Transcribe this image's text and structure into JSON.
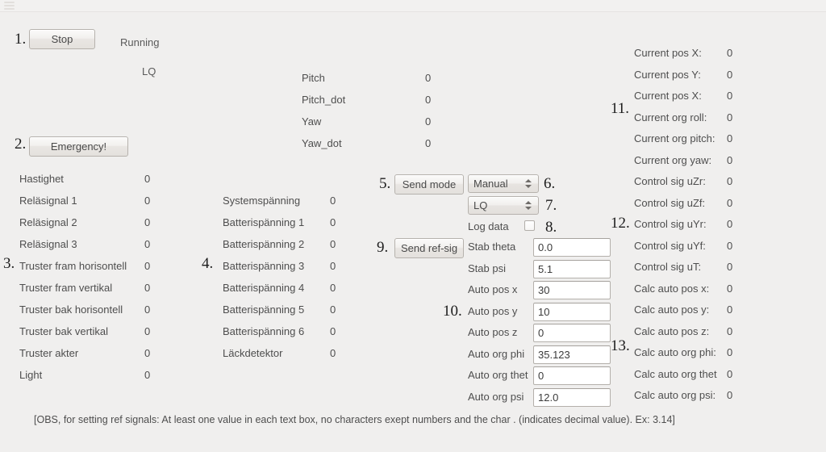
{
  "window": {
    "titlebar_icon": "menu-icon"
  },
  "controls": {
    "stop_button": "Stop",
    "emergency_button": "Emergency!",
    "send_mode_button": "Send mode",
    "send_refsig_button": "Send ref-sig",
    "mode_select_value": "Manual",
    "controller_select_value": "LQ",
    "log_data_label": "Log data",
    "log_data_checked": false
  },
  "status": {
    "running": "Running",
    "controller": "LQ"
  },
  "annotations": {
    "n1": "1.",
    "n2": "2.",
    "n3": "3.",
    "n4": "4.",
    "n5": "5.",
    "n6": "6.",
    "n7": "7.",
    "n8": "8.",
    "n9": "9.",
    "n10": "10.",
    "n11": "11.",
    "n12": "12.",
    "n13": "13."
  },
  "attitude": {
    "rows": [
      {
        "label": "Pitch",
        "value": "0"
      },
      {
        "label": "Pitch_dot",
        "value": "0"
      },
      {
        "label": "Yaw",
        "value": "0"
      },
      {
        "label": "Yaw_dot",
        "value": "0"
      }
    ]
  },
  "sensors_left": {
    "rows": [
      {
        "label": "Hastighet",
        "value": "0"
      },
      {
        "label": "Reläsignal 1",
        "value": "0"
      },
      {
        "label": "Reläsignal 2",
        "value": "0"
      },
      {
        "label": "Reläsignal 3",
        "value": "0"
      },
      {
        "label": "Truster fram horisontell",
        "value": "0"
      },
      {
        "label": "Truster fram vertikal",
        "value": "0"
      },
      {
        "label": "Truster bak horisontell",
        "value": "0"
      },
      {
        "label": "Truster bak vertikal",
        "value": "0"
      },
      {
        "label": "Truster akter",
        "value": "0"
      },
      {
        "label": "Light",
        "value": "0"
      }
    ]
  },
  "power": {
    "rows": [
      {
        "label": "Systemspänning",
        "value": "0"
      },
      {
        "label": "Batterispänning 1",
        "value": "0"
      },
      {
        "label": "Batterispänning 2",
        "value": "0"
      },
      {
        "label": "Batterispänning 3",
        "value": "0"
      },
      {
        "label": "Batterispänning 4",
        "value": "0"
      },
      {
        "label": "Batterispänning 5",
        "value": "0"
      },
      {
        "label": "Batterispänning 6",
        "value": "0"
      },
      {
        "label": "Läckdetektor",
        "value": "0"
      }
    ]
  },
  "refsig": {
    "rows": [
      {
        "label": "Stab theta",
        "value": "0.0"
      },
      {
        "label": "Stab psi",
        "value": "5.1"
      },
      {
        "label": "Auto pos x",
        "value": "30"
      },
      {
        "label": "Auto pos y",
        "value": "10"
      },
      {
        "label": "Auto pos z",
        "value": "0"
      },
      {
        "label": "Auto org phi",
        "value": "35.123"
      },
      {
        "label": "Auto org thet",
        "value": "0"
      },
      {
        "label": "Auto org psi",
        "value": "12.0"
      }
    ]
  },
  "readouts_right": {
    "rows": [
      {
        "label": "Current pos X:",
        "value": "0"
      },
      {
        "label": "Current pos Y:",
        "value": "0"
      },
      {
        "label": "Current pos X:",
        "value": "0"
      },
      {
        "label": "Current org roll:",
        "value": "0"
      },
      {
        "label": "Current org pitch:",
        "value": "0"
      },
      {
        "label": "Current org yaw:",
        "value": "0"
      },
      {
        "label": "Control sig uZr:",
        "value": "0"
      },
      {
        "label": "Control sig uZf:",
        "value": "0"
      },
      {
        "label": "Control sig uYr:",
        "value": "0"
      },
      {
        "label": "Control sig uYf:",
        "value": "0"
      },
      {
        "label": "Control sig uT:",
        "value": "0"
      },
      {
        "label": "Calc auto pos x:",
        "value": "0"
      },
      {
        "label": "Calc auto pos y:",
        "value": "0"
      },
      {
        "label": "Calc auto pos z:",
        "value": "0"
      },
      {
        "label": "Calc auto org phi:",
        "value": "0"
      },
      {
        "label": "Calc auto org thet",
        "value": "0"
      },
      {
        "label": "Calc auto org psi:",
        "value": "0"
      }
    ]
  },
  "footer": {
    "note": "[OBS, for setting ref signals: At least one value in each text box, no characters exept numbers and the char . (indicates decimal value). Ex: 3.14]"
  },
  "colors": {
    "background": "#f0efee",
    "text": "#4e4e4e",
    "annotation": "#1d1d1d",
    "border": "#b6b2ad"
  }
}
